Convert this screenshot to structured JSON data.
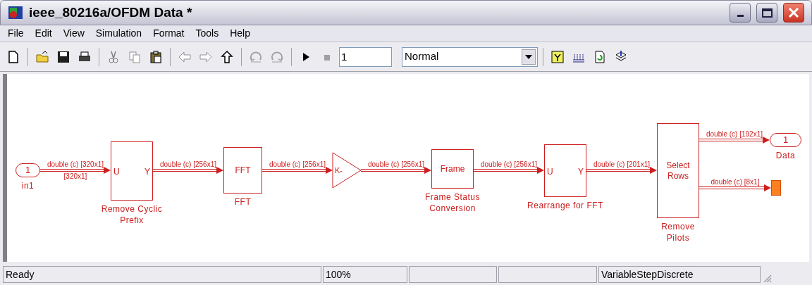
{
  "window": {
    "title": "ieee_80216a/OFDM Data *"
  },
  "menu": [
    "File",
    "Edit",
    "View",
    "Simulation",
    "Format",
    "Tools",
    "Help"
  ],
  "toolbar": {
    "stop_time": "1",
    "simulation_mode": "Normal"
  },
  "diagram": {
    "blocks": [
      {
        "kind": "inport",
        "text": "1",
        "label": "in1"
      },
      {
        "kind": "subsystem",
        "ports": [
          "U",
          "Y"
        ],
        "label": "Remove Cyclic\nPrefix"
      },
      {
        "kind": "box",
        "text": "FFT",
        "label": "FFT"
      },
      {
        "kind": "gain",
        "text": "K-"
      },
      {
        "kind": "box",
        "text": "Frame",
        "label": "Frame Status\nConversion"
      },
      {
        "kind": "subsystem",
        "ports": [
          "U",
          "Y"
        ],
        "label": "Rearrange for FFT"
      },
      {
        "kind": "box",
        "text": "Select\nRows",
        "label": "Remove\nPilots"
      },
      {
        "kind": "outport",
        "text": "1",
        "label": "Data"
      },
      {
        "kind": "terminator"
      }
    ],
    "signals": [
      {
        "label": "double (c) [320x1]",
        "dimension": "[320x1]"
      },
      {
        "label": "double (c) [256x1]"
      },
      {
        "label": "double (c) [256x1]"
      },
      {
        "label": "double (c) [256x1]"
      },
      {
        "label": "double (c) [256x1]"
      },
      {
        "label": "double (c) [201x1]"
      },
      {
        "label": "double (c) [192x1]"
      },
      {
        "label": "double (c) [8x1]"
      }
    ]
  },
  "status_bar": {
    "message": "Ready",
    "zoom": "100%",
    "solver": "VariableStepDiscrete"
  }
}
